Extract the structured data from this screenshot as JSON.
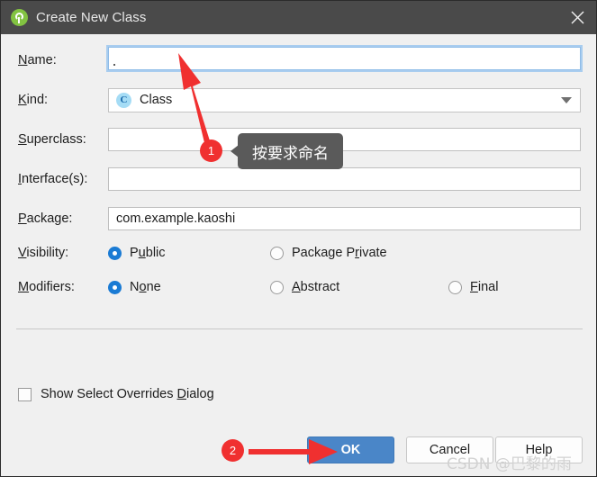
{
  "window": {
    "title": "Create New Class",
    "app_icon": "android-studio-icon",
    "close_icon": "close-icon",
    "titlebar_color": "#4a4a4a",
    "background_color": "#f0f0f0"
  },
  "form": {
    "name": {
      "label_pre": "N",
      "label_post": "ame:",
      "value": "",
      "focused": true
    },
    "kind": {
      "label_pre": "K",
      "label_post": "ind:",
      "value": "Class",
      "icon": "class-c-icon",
      "dropdown_icon": "chevron-down-icon"
    },
    "superclass": {
      "label_pre": "S",
      "label_post": "uperclass:",
      "value": ""
    },
    "interfaces": {
      "label_pre": "I",
      "label_post": "nterface(s):",
      "value": ""
    },
    "package": {
      "label_pre": "P",
      "label_post": "ackage:",
      "value": "com.example.kaoshi"
    },
    "visibility": {
      "label_pre": "V",
      "label_post": "isibility:",
      "options": [
        {
          "pre": "P",
          "mid": "u",
          "post": "blic",
          "selected": true
        },
        {
          "pre": "Package P",
          "mid": "r",
          "post": "ivate",
          "selected": false
        }
      ]
    },
    "modifiers": {
      "label_pre": "M",
      "label_post": "odifiers:",
      "options": [
        {
          "pre": "N",
          "mid": "o",
          "post": "ne",
          "selected": true
        },
        {
          "pre": "",
          "mid": "A",
          "post": "bstract",
          "selected": false
        },
        {
          "pre": "",
          "mid": "F",
          "post": "inal",
          "selected": false
        }
      ]
    },
    "show_overrides": {
      "pre": "Show Select Overrides ",
      "mid": "D",
      "post": "ialog",
      "checked": false
    }
  },
  "buttons": {
    "ok": "OK",
    "cancel": "Cancel",
    "help": "Help",
    "ok_color": "#4a86c8"
  },
  "annotations": {
    "badge_1": "1",
    "badge_2": "2",
    "tooltip_text": "按要求命名",
    "arrow_color": "#f03030"
  },
  "watermark": "CSDN @巴黎的雨"
}
